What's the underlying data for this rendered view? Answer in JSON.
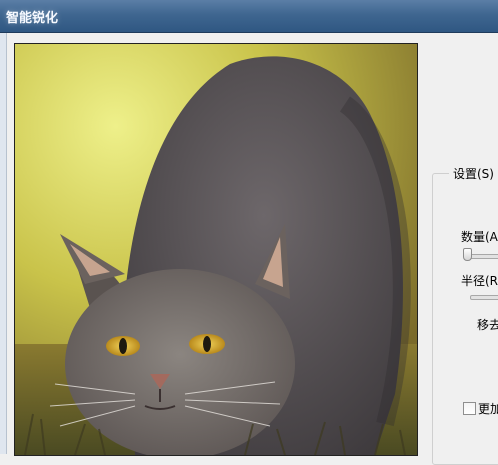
{
  "window": {
    "title": "智能锐化"
  },
  "settings": {
    "group_label": "设置(S)",
    "amount_label": "数量(A",
    "radius_label": "半径(R",
    "remove_label": "移去",
    "more_label": "更加"
  },
  "colors": {
    "titlebar": "#3f6690",
    "dialog_bg": "#f0f0f0"
  }
}
